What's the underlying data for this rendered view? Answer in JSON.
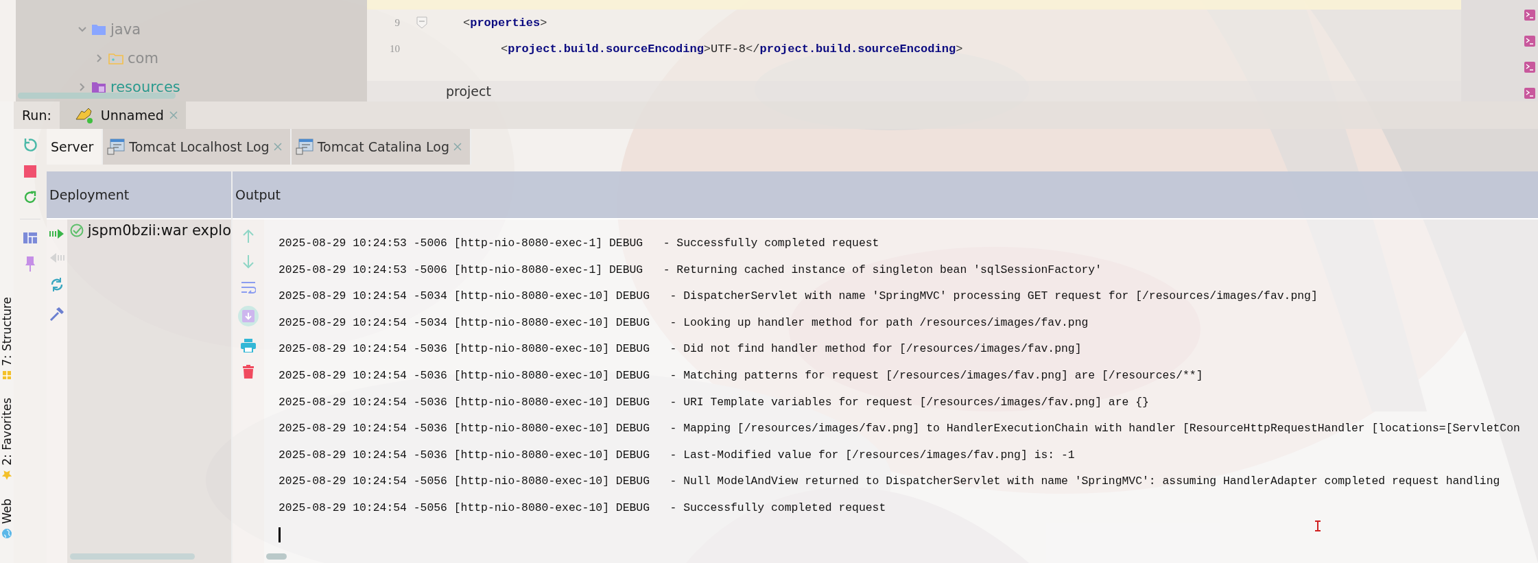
{
  "project_tree": {
    "items": [
      {
        "label": "java",
        "kind": "source",
        "expanded": true,
        "children": [
          {
            "label": "com",
            "kind": "package",
            "expanded": false
          }
        ]
      },
      {
        "label": "resources",
        "kind": "resources",
        "expanded": false
      }
    ]
  },
  "editor": {
    "lines": [
      {
        "number": "9",
        "code": "<properties>",
        "children": [
          {
            "number": "10",
            "code": "<project.build.sourceEncoding>UTF-8</project.build.sourceEncoding>"
          }
        ]
      }
    ],
    "breadcrumb": "project"
  },
  "run": {
    "label": "Run:",
    "tabs": [
      {
        "label": "Unnamed",
        "selected": true
      }
    ]
  },
  "tool_windows": [
    {
      "label": "7: Structure",
      "kind": "structure"
    },
    {
      "label": "2: Favorites",
      "kind": "favorites"
    },
    {
      "label": "Web",
      "kind": "web"
    }
  ],
  "services": {
    "tabs": [
      {
        "label": "Server",
        "kind": "plain",
        "selected": true
      },
      {
        "label": "Tomcat Localhost Log",
        "kind": "log",
        "selected": false
      },
      {
        "label": "Tomcat Catalina Log",
        "kind": "log",
        "selected": false
      }
    ]
  },
  "deployment": {
    "header": "Deployment",
    "items": [
      {
        "label": "jspm0bzii:war explo",
        "deployed": true
      }
    ]
  },
  "output": {
    "header": "Output",
    "lines": [
      "2025-08-29 10:24:53 -5006 [http-nio-8080-exec-1] DEBUG   - Successfully completed request",
      "2025-08-29 10:24:53 -5006 [http-nio-8080-exec-1] DEBUG   - Returning cached instance of singleton bean 'sqlSessionFactory'",
      "2025-08-29 10:24:54 -5034 [http-nio-8080-exec-10] DEBUG   - DispatcherServlet with name 'SpringMVC' processing GET request for [/resources/images/fav.png]",
      "2025-08-29 10:24:54 -5034 [http-nio-8080-exec-10] DEBUG   - Looking up handler method for path /resources/images/fav.png",
      "2025-08-29 10:24:54 -5036 [http-nio-8080-exec-10] DEBUG   - Did not find handler method for [/resources/images/fav.png]",
      "2025-08-29 10:24:54 -5036 [http-nio-8080-exec-10] DEBUG   - Matching patterns for request [/resources/images/fav.png] are [/resources/**]",
      "2025-08-29 10:24:54 -5036 [http-nio-8080-exec-10] DEBUG   - URI Template variables for request [/resources/images/fav.png] are {}",
      "2025-08-29 10:24:54 -5036 [http-nio-8080-exec-10] DEBUG   - Mapping [/resources/images/fav.png] to HandlerExecutionChain with handler [ResourceHttpRequestHandler [locations=[ServletCon",
      "2025-08-29 10:24:54 -5036 [http-nio-8080-exec-10] DEBUG   - Last-Modified value for [/resources/images/fav.png] is: -1",
      "2025-08-29 10:24:54 -5056 [http-nio-8080-exec-10] DEBUG   - Null ModelAndView returned to DispatcherServlet with name 'SpringMVC': assuming HandlerAdapter completed request handling",
      "2025-08-29 10:24:54 -5056 [http-nio-8080-exec-10] DEBUG   - Successfully completed request"
    ]
  }
}
